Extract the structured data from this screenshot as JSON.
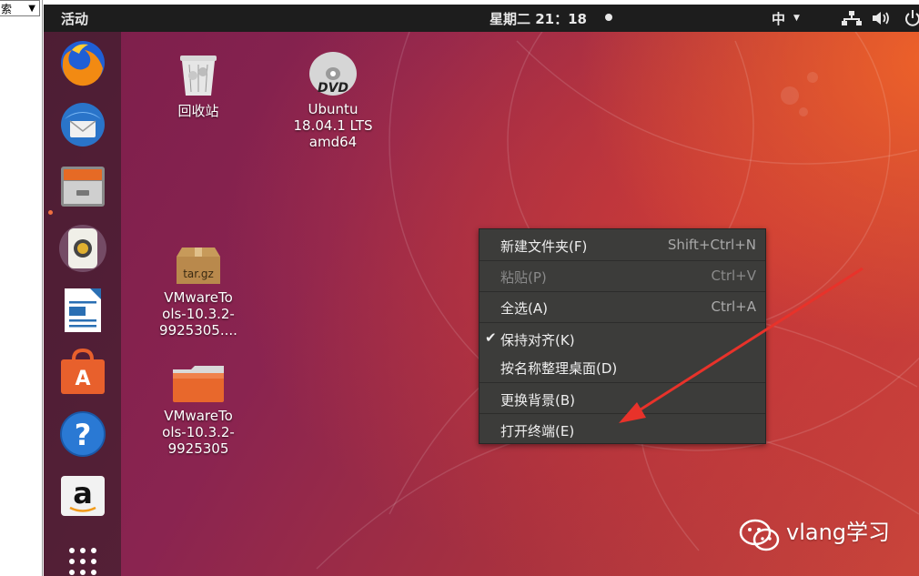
{
  "host": {
    "combo_text": "索"
  },
  "topbar": {
    "activities": "活动",
    "clock": "星期二 21：18",
    "input_method": "中"
  },
  "dock": {
    "items": [
      "firefox-icon",
      "thunderbird-icon",
      "files-icon",
      "rhythmbox-icon",
      "libreoffice-writer-icon",
      "software-center-icon",
      "help-icon",
      "amazon-icon",
      "show-applications-icon"
    ]
  },
  "desktop": {
    "icons": [
      {
        "label": "回收站"
      },
      {
        "label": "Ubuntu 18.04.1 LTS amd64",
        "lines": [
          "Ubuntu",
          "18.04.1 LTS",
          "amd64"
        ]
      },
      {
        "label": "VMwareTools-10.3.2-9925305....",
        "lines": [
          "VMwareTo",
          "ols-10.3.2-",
          "9925305...."
        ]
      },
      {
        "label": "VMwareTools-10.3.2-9925305",
        "lines": [
          "VMwareTo",
          "ols-10.3.2-",
          "9925305"
        ]
      }
    ],
    "tar_badge": "tar.gz",
    "dvd_badge": "DVD"
  },
  "context_menu": {
    "items": [
      {
        "label": "新建文件夹(F)",
        "accel": "Shift+Ctrl+N",
        "enabled": true
      },
      {
        "label": "粘贴(P)",
        "accel": "Ctrl+V",
        "enabled": false
      },
      {
        "label": "全选(A)",
        "accel": "Ctrl+A",
        "enabled": true
      },
      {
        "label": "保持对齐(K)",
        "accel": "",
        "enabled": true,
        "checked": true
      },
      {
        "label": "按名称整理桌面(D)",
        "accel": "",
        "enabled": true
      },
      {
        "label": "更换背景(B)",
        "accel": "",
        "enabled": true
      },
      {
        "label": "打开终端(E)",
        "accel": "",
        "enabled": true
      }
    ]
  },
  "watermark": {
    "text": "vlang学习"
  },
  "colors": {
    "menu_bg": "#3c3c3a",
    "topbar_bg": "#1d1d1d",
    "annotation_arrow": "#e8322a",
    "accent_orange": "#f07040"
  }
}
